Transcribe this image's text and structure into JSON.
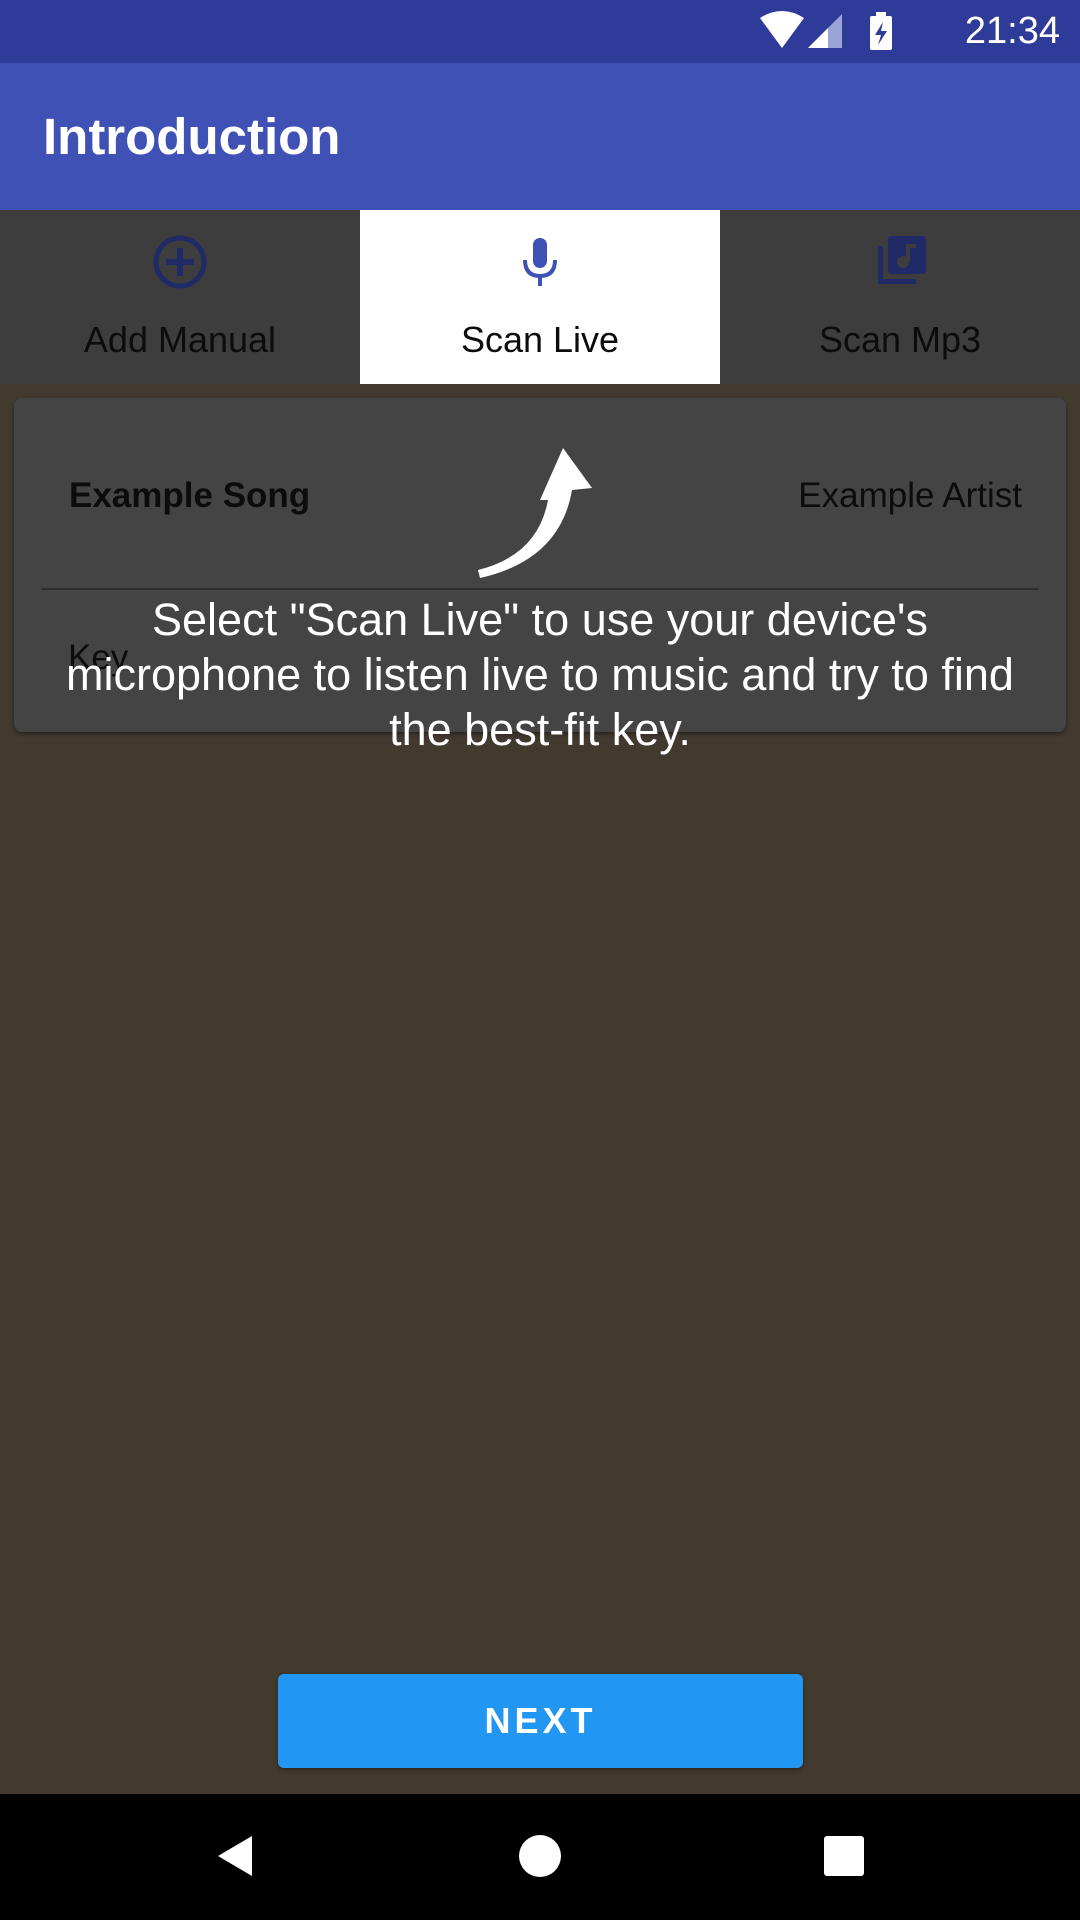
{
  "status_bar": {
    "time": "21:34",
    "icons": [
      "wifi-icon",
      "cell-signal-icon",
      "battery-charging-icon"
    ]
  },
  "app_bar": {
    "title": "Introduction"
  },
  "tabs": [
    {
      "label": "Add Manual",
      "icon": "add-circle-icon",
      "active": false
    },
    {
      "label": "Scan Live",
      "icon": "microphone-icon",
      "active": true
    },
    {
      "label": "Scan Mp3",
      "icon": "music-library-icon",
      "active": false
    }
  ],
  "song_card": {
    "title": "Example Song",
    "artist": "Example Artist",
    "key_label": "Key"
  },
  "tutorial": {
    "text": "Select \"Scan Live\" to use your device's microphone to listen live to music and try to find the best-fit key."
  },
  "actions": {
    "next_label": "NEXT"
  },
  "nav_bar": {
    "buttons": [
      "back-icon",
      "home-icon",
      "recents-icon"
    ]
  },
  "colors": {
    "status_bar": "#2f3b98",
    "app_bar": "#3f51b5",
    "accent": "#2196f3",
    "overlay": "#423a2f"
  }
}
